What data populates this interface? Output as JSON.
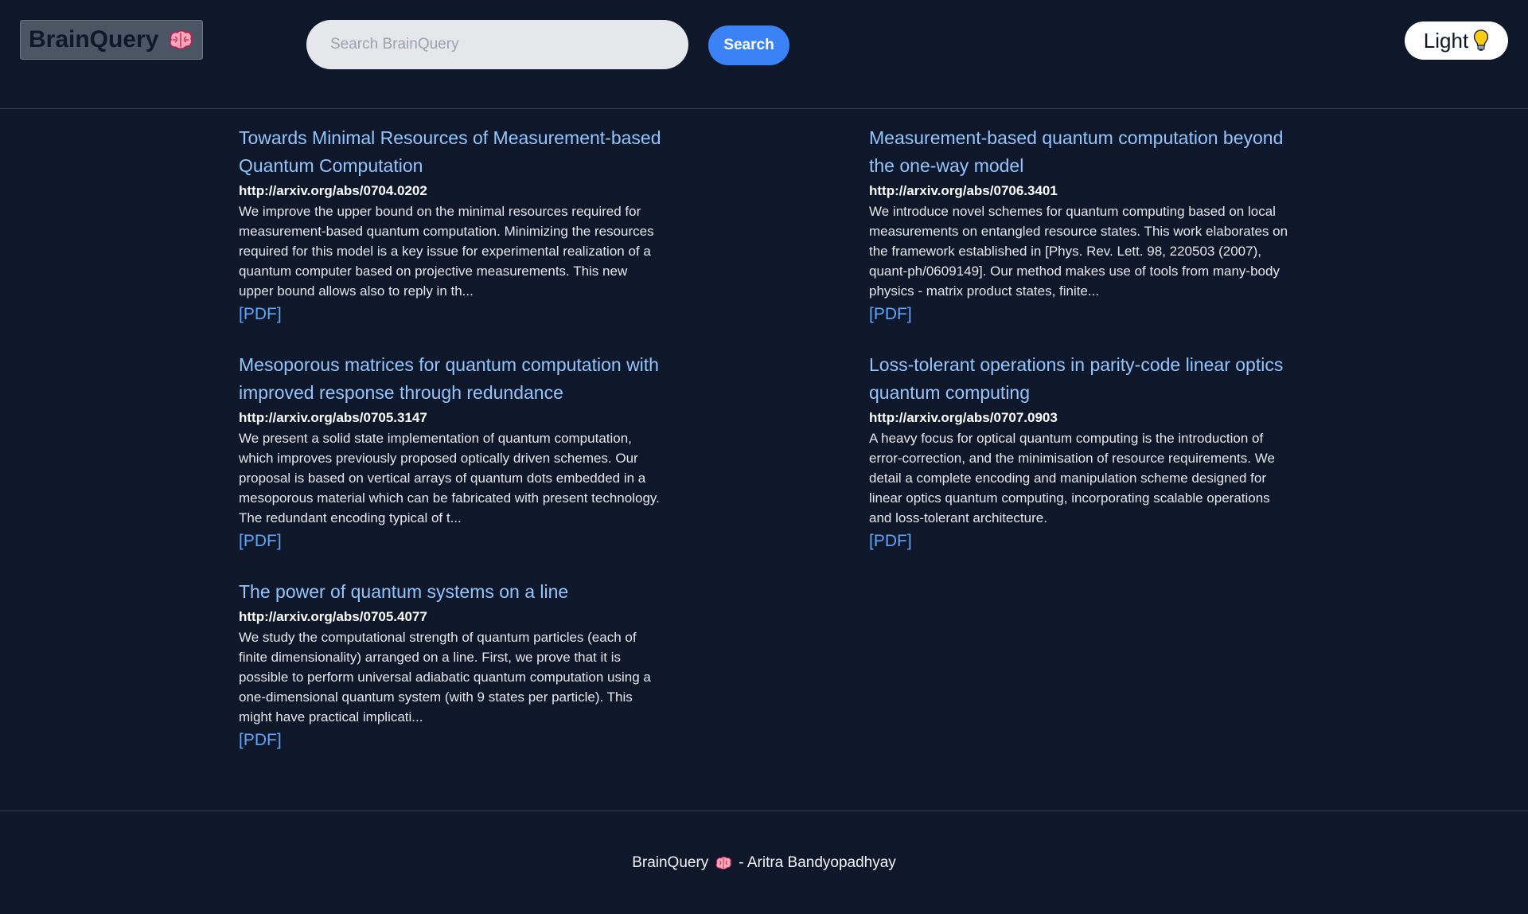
{
  "header": {
    "logo_text": "BrainQuery",
    "logo_icon": "brain-icon",
    "search_placeholder": "Search BrainQuery",
    "search_value": "",
    "search_button_label": "Search",
    "theme_toggle_label": "Light",
    "theme_toggle_icon": "lightbulb-icon"
  },
  "results": [
    {
      "title": "Towards Minimal Resources of Measurement-based Quantum Computation",
      "url": "http://arxiv.org/abs/0704.0202",
      "abstract": "We improve the upper bound on the minimal resources required for measurement-based quantum computation. Minimizing the resources required for this model is a key issue for experimental realization of a quantum computer based on projective measurements. This new upper bound allows also to reply in th...",
      "pdf_label": "[PDF]"
    },
    {
      "title": "Measurement-based quantum computation beyond the one-way model",
      "url": "http://arxiv.org/abs/0706.3401",
      "abstract": "We introduce novel schemes for quantum computing based on local measurements on entangled resource states. This work elaborates on the framework established in [Phys. Rev. Lett. 98, 220503 (2007), quant-ph/0609149]. Our method makes use of tools from many-body physics - matrix product states, finite...",
      "pdf_label": "[PDF]"
    },
    {
      "title": "Mesoporous matrices for quantum computation with improved response through redundance",
      "url": "http://arxiv.org/abs/0705.3147",
      "abstract": "We present a solid state implementation of quantum computation, which improves previously proposed optically driven schemes. Our proposal is based on vertical arrays of quantum dots embedded in a mesoporous material which can be fabricated with present technology. The redundant encoding typical of t...",
      "pdf_label": "[PDF]"
    },
    {
      "title": "Loss-tolerant operations in parity-code linear optics quantum computing",
      "url": "http://arxiv.org/abs/0707.0903",
      "abstract": "A heavy focus for optical quantum computing is the introduction of error-correction, and the minimisation of resource requirements. We detail a complete encoding and manipulation scheme designed for linear optics quantum computing, incorporating scalable operations and loss-tolerant architecture.",
      "pdf_label": "[PDF]"
    },
    {
      "title": "The power of quantum systems on a line",
      "url": "http://arxiv.org/abs/0705.4077",
      "abstract": "We study the computational strength of quantum particles (each of finite dimensionality) arranged on a line. First, we prove that it is possible to perform universal adiabatic quantum computation using a one-dimensional quantum system (with 9 states per particle). This might have practical implicati...",
      "pdf_label": "[PDF]"
    }
  ],
  "footer": {
    "brand": "BrainQuery",
    "icon": "brain-icon",
    "author": "- Aritra Bandyopadhyay"
  },
  "colors": {
    "background": "#0f172a",
    "title_link": "#93c5fd",
    "pdf_link": "#60a5fa",
    "search_button": "#3b82f6",
    "logo_bg": "#4b5563"
  }
}
